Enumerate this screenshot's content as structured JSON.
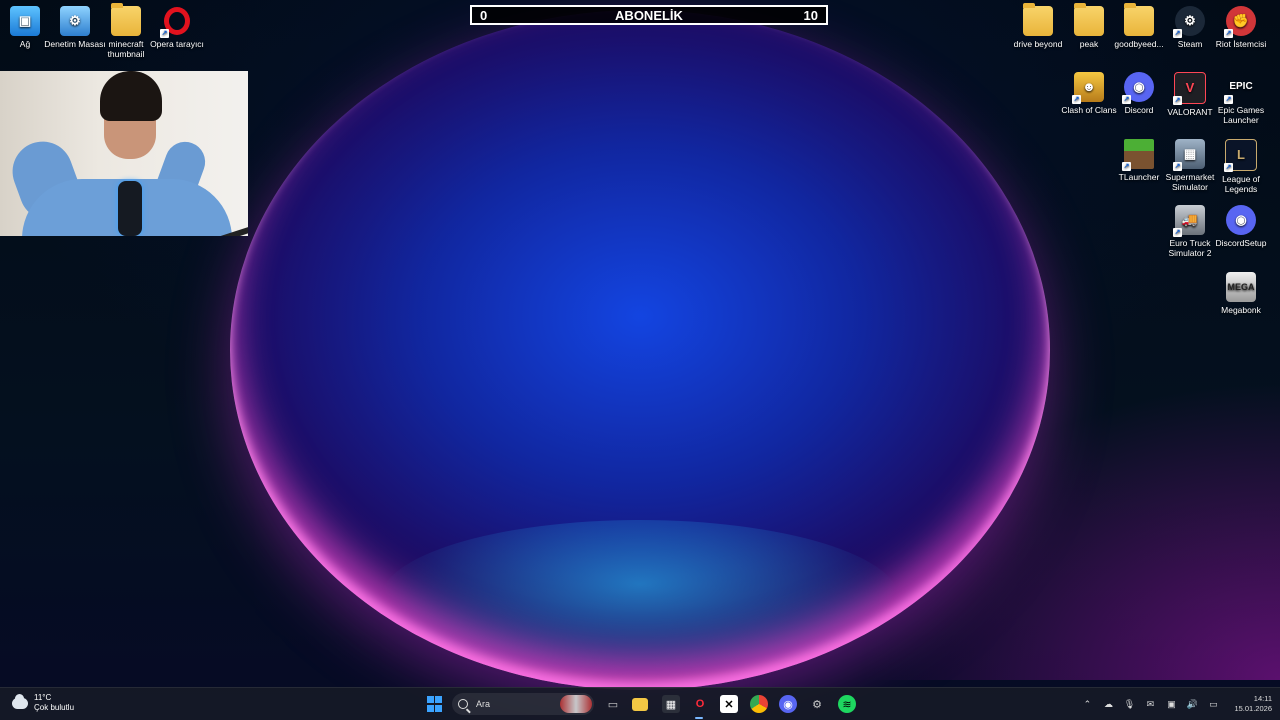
{
  "subscriber_bar": {
    "current": "0",
    "label": "ABONELİK",
    "goal": "10"
  },
  "desktop_left": [
    {
      "id": "ag",
      "label": "Ağ"
    },
    {
      "id": "denetim",
      "label": "Denetim Masası"
    },
    {
      "id": "minecraft",
      "label": "minecraft thumbnail"
    },
    {
      "id": "opera",
      "label": "Opera tarayıcı"
    }
  ],
  "desktop_right": [
    {
      "id": "drive-beyond",
      "label": "drive beyond"
    },
    {
      "id": "peak",
      "label": "peak"
    },
    {
      "id": "goodbyeed",
      "label": "goodbyeed..."
    },
    {
      "id": "steam",
      "label": "Steam"
    },
    {
      "id": "riot",
      "label": "Riot İstemcisi"
    },
    {
      "id": "coc",
      "label": "Clash of Clans"
    },
    {
      "id": "discord",
      "label": "Discord"
    },
    {
      "id": "valorant",
      "label": "VALORANT"
    },
    {
      "id": "epic",
      "label": "Epic Games Launcher"
    },
    {
      "id": "tlauncher",
      "label": "TLauncher"
    },
    {
      "id": "supermarket",
      "label": "Supermarket Simulator"
    },
    {
      "id": "lol",
      "label": "League of Legends"
    },
    {
      "id": "ets2",
      "label": "Euro Truck Simulator 2"
    },
    {
      "id": "discordsetup",
      "label": "DiscordSetup"
    },
    {
      "id": "megabonk",
      "label": "Megabonk"
    }
  ],
  "icon_glyphs": {
    "epic": "EPIC",
    "mega": "MEGA"
  },
  "taskbar": {
    "weather_temp": "11°C",
    "weather_desc": "Çok bulutlu",
    "search_placeholder": "Ara",
    "time": "14:11",
    "date": "15.01.2026"
  }
}
